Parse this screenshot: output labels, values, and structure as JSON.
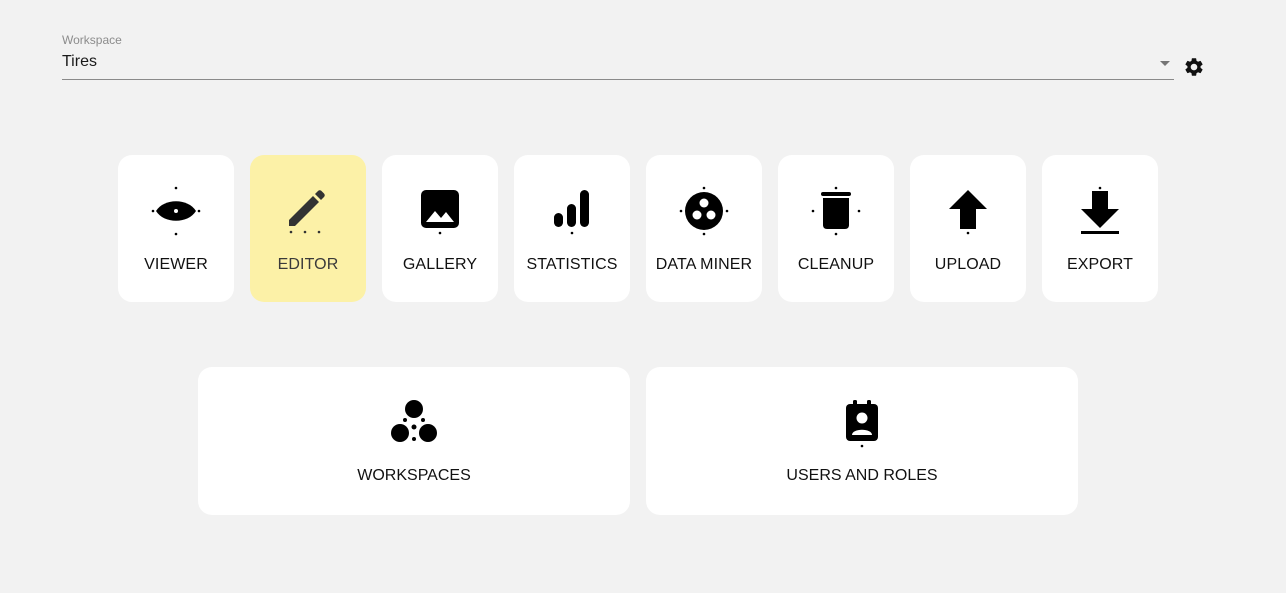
{
  "workspace": {
    "label": "Workspace",
    "value": "Tires",
    "dropdown_icon": "caret-down-icon",
    "settings_icon": "gear-icon"
  },
  "tiles": [
    {
      "label": "VIEWER",
      "icon": "eye-icon",
      "active": false
    },
    {
      "label": "EDITOR",
      "icon": "pencil-icon",
      "active": true
    },
    {
      "label": "GALLERY",
      "icon": "image-icon",
      "active": false
    },
    {
      "label": "STATISTICS",
      "icon": "bar-chart-icon",
      "active": false
    },
    {
      "label": "DATA MINER",
      "icon": "data-miner-icon",
      "active": false
    },
    {
      "label": "CLEANUP",
      "icon": "trash-icon",
      "active": false
    },
    {
      "label": "UPLOAD",
      "icon": "upload-arrow-icon",
      "active": false
    },
    {
      "label": "EXPORT",
      "icon": "download-arrow-icon",
      "active": false
    }
  ],
  "cards": [
    {
      "label": "WORKSPACES",
      "icon": "workspaces-icon"
    },
    {
      "label": "USERS AND ROLES",
      "icon": "user-badge-icon"
    }
  ],
  "colors": {
    "background": "#f2f2f2",
    "tile": "#ffffff",
    "active_tile": "#fcf1a7"
  }
}
